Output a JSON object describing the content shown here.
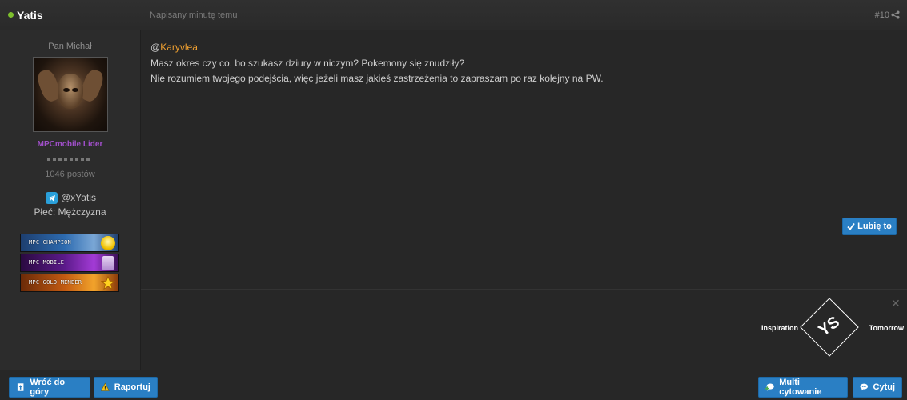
{
  "header": {
    "author": "Yatis",
    "date": "Napisany minutę temu",
    "post_number": "#10"
  },
  "sidebar": {
    "user_title": "Pan Michał",
    "rank": "MPCmobile Lider",
    "post_count": "1046 postów",
    "telegram_handle": "@xYatis",
    "gender": "Płeć: Mężczyzna",
    "awards": [
      {
        "label": "MPC CHAMPION"
      },
      {
        "label": "MPC MOBILE"
      },
      {
        "label": "MPC GOLD MEMBER"
      }
    ]
  },
  "post": {
    "mention_at": "@",
    "mention_nick": "Karyvlea",
    "lines": [
      "Masz okres czy co, bo szukasz dziury w niczym? Pokemony się znudziły?",
      "Nie rozumiem twojego podejścia, więc jeżeli masz jakieś zastrzeżenia to zapraszam po raz kolejny na PW."
    ],
    "like_label": "Lubię to"
  },
  "ad": {
    "left_text": "Inspiration",
    "logo_text": "YS",
    "right_text": "Tomorrow"
  },
  "footer": {
    "back_to_top": "Wróć do góry",
    "report": "Raportuj",
    "multi_quote": "Multi cytowanie",
    "quote": "Cytuj"
  },
  "colors": {
    "accent_button": "#2a7fc4",
    "mention": "#f0a030",
    "rank": "#a04fc9",
    "online": "#7dbf2c"
  }
}
